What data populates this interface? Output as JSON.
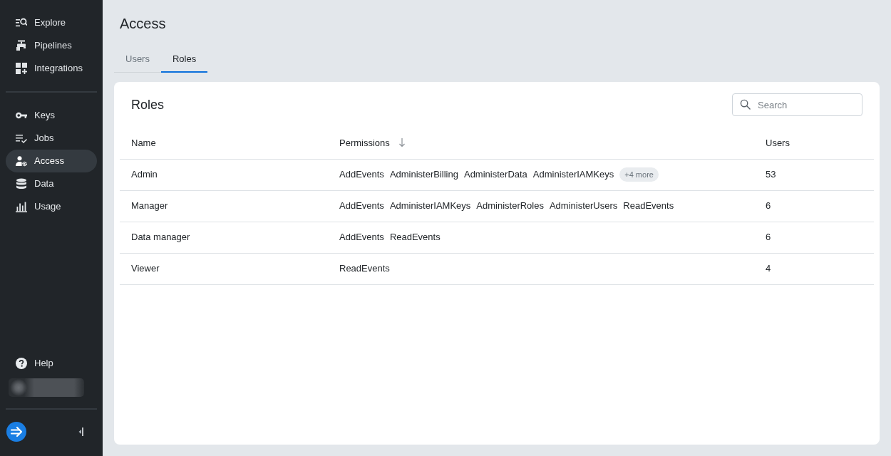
{
  "sidebar": {
    "sections": [
      {
        "items": [
          {
            "label": "Explore",
            "selected": false
          },
          {
            "label": "Pipelines",
            "selected": false
          },
          {
            "label": "Integrations",
            "selected": false
          }
        ]
      },
      {
        "items": [
          {
            "label": "Keys",
            "selected": false
          },
          {
            "label": "Jobs",
            "selected": false
          },
          {
            "label": "Access",
            "selected": true
          },
          {
            "label": "Data",
            "selected": false
          },
          {
            "label": "Usage",
            "selected": false
          }
        ]
      }
    ],
    "footer": {
      "help": {
        "label": "Help"
      }
    }
  },
  "page": {
    "title": "Access"
  },
  "tabs": [
    {
      "label": "Users",
      "selected": false
    },
    {
      "label": "Roles",
      "selected": true
    }
  ],
  "card": {
    "title": "Roles",
    "search": {
      "placeholder": "Search"
    },
    "table": {
      "columns": [
        {
          "label": "Name",
          "sorted": false
        },
        {
          "label": "Permissions",
          "sorted": true
        },
        {
          "label": "Users",
          "sorted": false
        }
      ],
      "rows": [
        {
          "name": "Admin",
          "permissions": [
            "AddEvents",
            "AdministerBilling",
            "AdministerData",
            "AdministerIAMKeys"
          ],
          "more": "+4 more",
          "users": "53"
        },
        {
          "name": "Manager",
          "permissions": [
            "AddEvents",
            "AdministerIAMKeys",
            "AdministerRoles",
            "AdministerUsers",
            "ReadEvents"
          ],
          "users": "6"
        },
        {
          "name": "Data manager",
          "permissions": [
            "AddEvents",
            "ReadEvents"
          ],
          "users": "6"
        },
        {
          "name": "Viewer",
          "permissions": [
            "ReadEvents"
          ],
          "users": "4"
        }
      ]
    }
  }
}
